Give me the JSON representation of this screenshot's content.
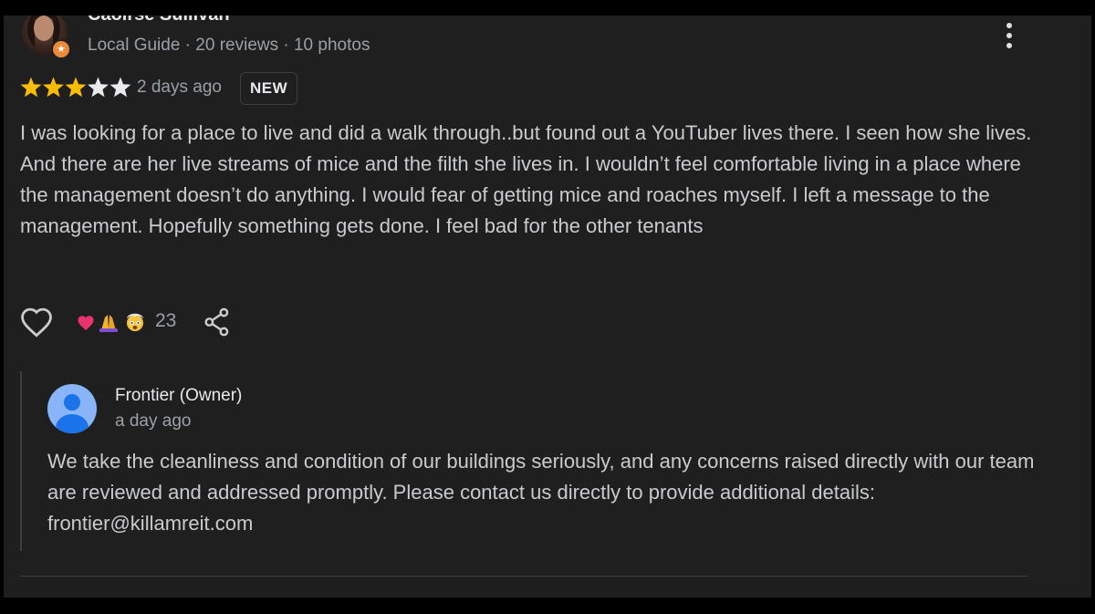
{
  "review": {
    "reviewer_name": "Caoirse Sullivan",
    "reviewer_meta": "Local Guide · 20 reviews · 10 photos",
    "rating": 3,
    "rating_max": 5,
    "date": "2 days ago",
    "badge": "NEW",
    "text": "I was looking for a place to live and did a walk through..but found out a YouTuber lives there. I seen how she lives. And there are her live streams of mice and the filth she lives in. I wouldn’t feel comfortable living in a place where the management doesn’t do anything. I would fear of getting mice and roaches myself. I left a message to the management. Hopefully something gets done. I feel bad for the other tenants",
    "reaction_emojis": [
      "heart",
      "folded-hands",
      "exploding-head"
    ],
    "reaction_count": "23"
  },
  "owner_response": {
    "name": "Frontier (Owner)",
    "date": "a day ago",
    "text": "We take the cleanliness and condition of our buildings seriously, and any concerns raised directly with our team are reviewed and addressed promptly. Please contact us directly to provide additional details: frontier@killamreit.com"
  },
  "icons": {
    "star_filled_color": "#fbbc04",
    "star_empty_color": "#e8eaed",
    "guide_badge_color": "#ea8a3a"
  }
}
